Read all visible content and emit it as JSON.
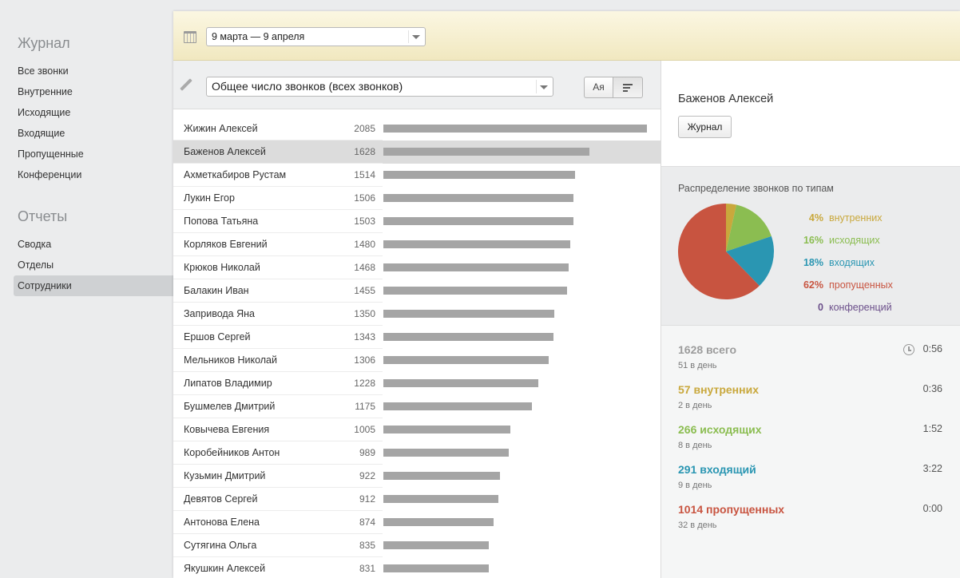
{
  "colors": {
    "internal": "#c9a83c",
    "outgoing": "#8bbd51",
    "incoming": "#2a96b2",
    "missed": "#c85440",
    "conference": "#6b4f8a",
    "total": "#9c9c9c",
    "bar": "#a5a5a5"
  },
  "sidebar": {
    "journal_title": "Журнал",
    "journal_items": [
      "Все звонки",
      "Внутренние",
      "Исходящие",
      "Входящие",
      "Пропущенные",
      "Конференции"
    ],
    "reports_title": "Отчеты",
    "reports_items": [
      "Сводка",
      "Отделы",
      "Сотрудники"
    ],
    "active_item": "Сотрудники"
  },
  "toolbar": {
    "calendar_icon": "calendar-icon",
    "date_range": "9 марта — 9 апреля",
    "metric": "Общее число звонков (всех звонков)",
    "sort_alpha_label": "Aя",
    "sort_value_icon": "sort-lines-icon"
  },
  "chart_data": {
    "type": "bar",
    "categories": [
      "Жижин Алексей",
      "Баженов Алексей",
      "Ахметкабиров Рустам",
      "Лукин Егор",
      "Попова Татьяна",
      "Корляков Евгений",
      "Крюков Николай",
      "Балакин Иван",
      "Запривода Яна",
      "Ершов Сергей",
      "Мельников Николай",
      "Липатов Владимир",
      "Бушмелев Дмитрий",
      "Ковычева Евгения",
      "Коробейников Антон",
      "Кузьмин Дмитрий",
      "Девятов Сергей",
      "Антонова Елена",
      "Сутягина Ольга",
      "Якушкин Алексей"
    ],
    "values": [
      2085,
      1628,
      1514,
      1506,
      1503,
      1480,
      1468,
      1455,
      1350,
      1343,
      1306,
      1228,
      1175,
      1005,
      989,
      922,
      912,
      874,
      835,
      831
    ],
    "selected": "Баженов Алексей"
  },
  "detail": {
    "name": "Баженов Алексей",
    "journal_button": "Журнал",
    "pie_title": "Распределение звонков по типам",
    "pie": [
      {
        "pct": "4%",
        "label": "внутренних",
        "value": 57
      },
      {
        "pct": "16%",
        "label": "исходящих",
        "value": 266
      },
      {
        "pct": "18%",
        "label": "входящих",
        "value": 291
      },
      {
        "pct": "62%",
        "label": "пропущенных",
        "value": 1014
      },
      {
        "pct": "0",
        "label": "конференций",
        "value": 0
      }
    ],
    "stats": [
      {
        "big": "1628 всего",
        "sub": "51 в день",
        "time": "0:56"
      },
      {
        "big": "57 внутренних",
        "sub": "2 в день",
        "time": "0:36"
      },
      {
        "big": "266 исходящих",
        "sub": "8 в день",
        "time": "1:52"
      },
      {
        "big": "291 входящий",
        "sub": "9 в день",
        "time": "3:22"
      },
      {
        "big": "1014 пропущенных",
        "sub": "32 в день",
        "time": "0:00"
      }
    ]
  }
}
